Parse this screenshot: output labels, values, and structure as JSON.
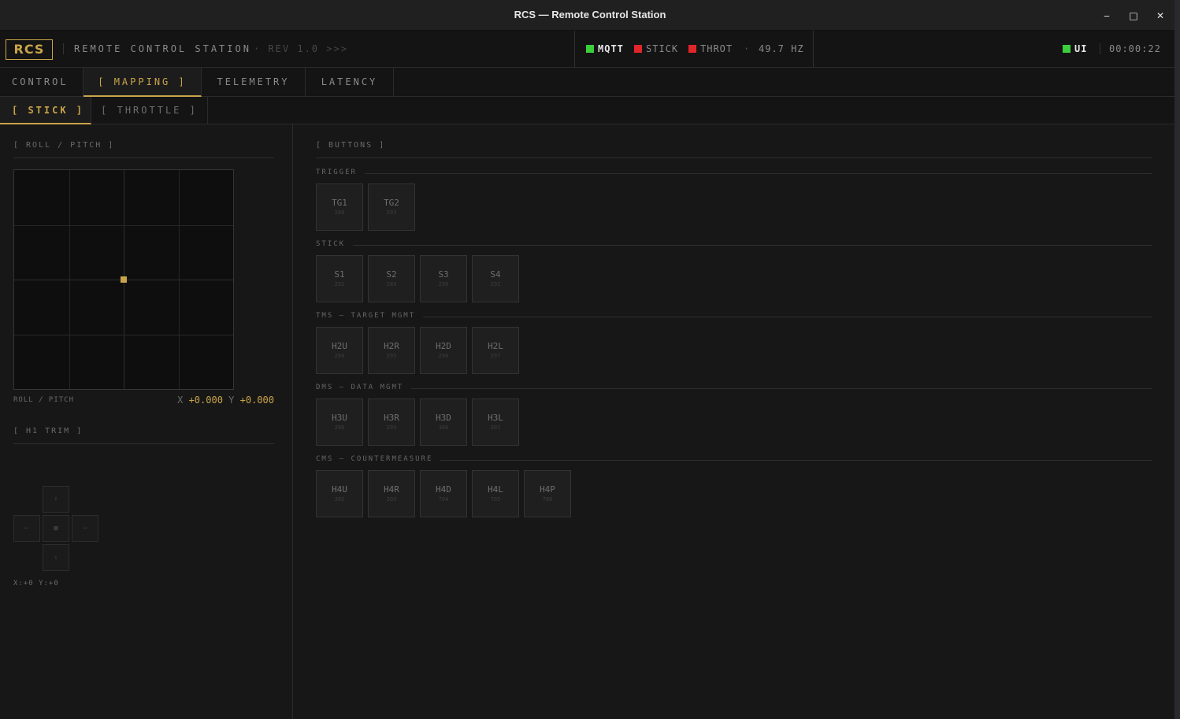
{
  "window": {
    "title": "RCS — Remote Control Station",
    "controls": {
      "minimize": "‒",
      "maximize": "□",
      "close": "✕"
    }
  },
  "header": {
    "logo": "RCS",
    "station_name": "REMOTE CONTROL STATION",
    "revision": "· REV 1.0 >>>",
    "status": [
      {
        "label": "MQTT",
        "color": "#3ccf3c"
      },
      {
        "label": "STICK",
        "color": "#e0262b"
      },
      {
        "label": "THROT",
        "color": "#e0262b"
      }
    ],
    "rate_sep": "·",
    "rate": "49.7 HZ",
    "ui_status": {
      "label": "UI",
      "color": "#3ccf3c"
    },
    "clock": "00:00:22"
  },
  "tabs": [
    {
      "label": "CONTROL",
      "active": false
    },
    {
      "label": "[ MAPPING ]",
      "active": true
    },
    {
      "label": "TELEMETRY",
      "active": false
    },
    {
      "label": "LATENCY",
      "active": false
    }
  ],
  "subtabs": [
    {
      "label": "[ STICK ]",
      "active": true
    },
    {
      "label": "[ THROTTLE ]",
      "active": false
    }
  ],
  "left": {
    "roll_pitch_title": "[ ROLL / PITCH ]",
    "roll_pitch_caption": "ROLL / PITCH",
    "x_label": "X",
    "x_value": "+0.000",
    "y_label": "Y",
    "y_value": "+0.000",
    "stick_x": 0.0,
    "stick_y": 0.0,
    "trim_title": "[ H1 TRIM ]",
    "trim_up": "↑",
    "trim_left": "←",
    "trim_center": "■",
    "trim_right": "→",
    "trim_down": "↓",
    "trim_readout": "X:+0 Y:+0"
  },
  "buttons_panel": {
    "title": "[ BUTTONS ]",
    "groups": [
      {
        "label": "TRIGGER",
        "buttons": [
          {
            "label": "TG1",
            "code": "288"
          },
          {
            "label": "TG2",
            "code": "293"
          }
        ]
      },
      {
        "label": "STICK",
        "buttons": [
          {
            "label": "S1",
            "code": "292"
          },
          {
            "label": "S2",
            "code": "289"
          },
          {
            "label": "S3",
            "code": "290"
          },
          {
            "label": "S4",
            "code": "291"
          }
        ]
      },
      {
        "label": "TMS — TARGET MGMT",
        "buttons": [
          {
            "label": "H2U",
            "code": "294"
          },
          {
            "label": "H2R",
            "code": "295"
          },
          {
            "label": "H2D",
            "code": "296"
          },
          {
            "label": "H2L",
            "code": "297"
          }
        ]
      },
      {
        "label": "DMS — DATA MGMT",
        "buttons": [
          {
            "label": "H3U",
            "code": "298"
          },
          {
            "label": "H3R",
            "code": "299"
          },
          {
            "label": "H3D",
            "code": "300"
          },
          {
            "label": "H3L",
            "code": "301"
          }
        ]
      },
      {
        "label": "CMS — COUNTERMEASURE",
        "buttons": [
          {
            "label": "H4U",
            "code": "302"
          },
          {
            "label": "H4R",
            "code": "303"
          },
          {
            "label": "H4D",
            "code": "704"
          },
          {
            "label": "H4L",
            "code": "705"
          },
          {
            "label": "H4P",
            "code": "706"
          }
        ]
      }
    ]
  }
}
